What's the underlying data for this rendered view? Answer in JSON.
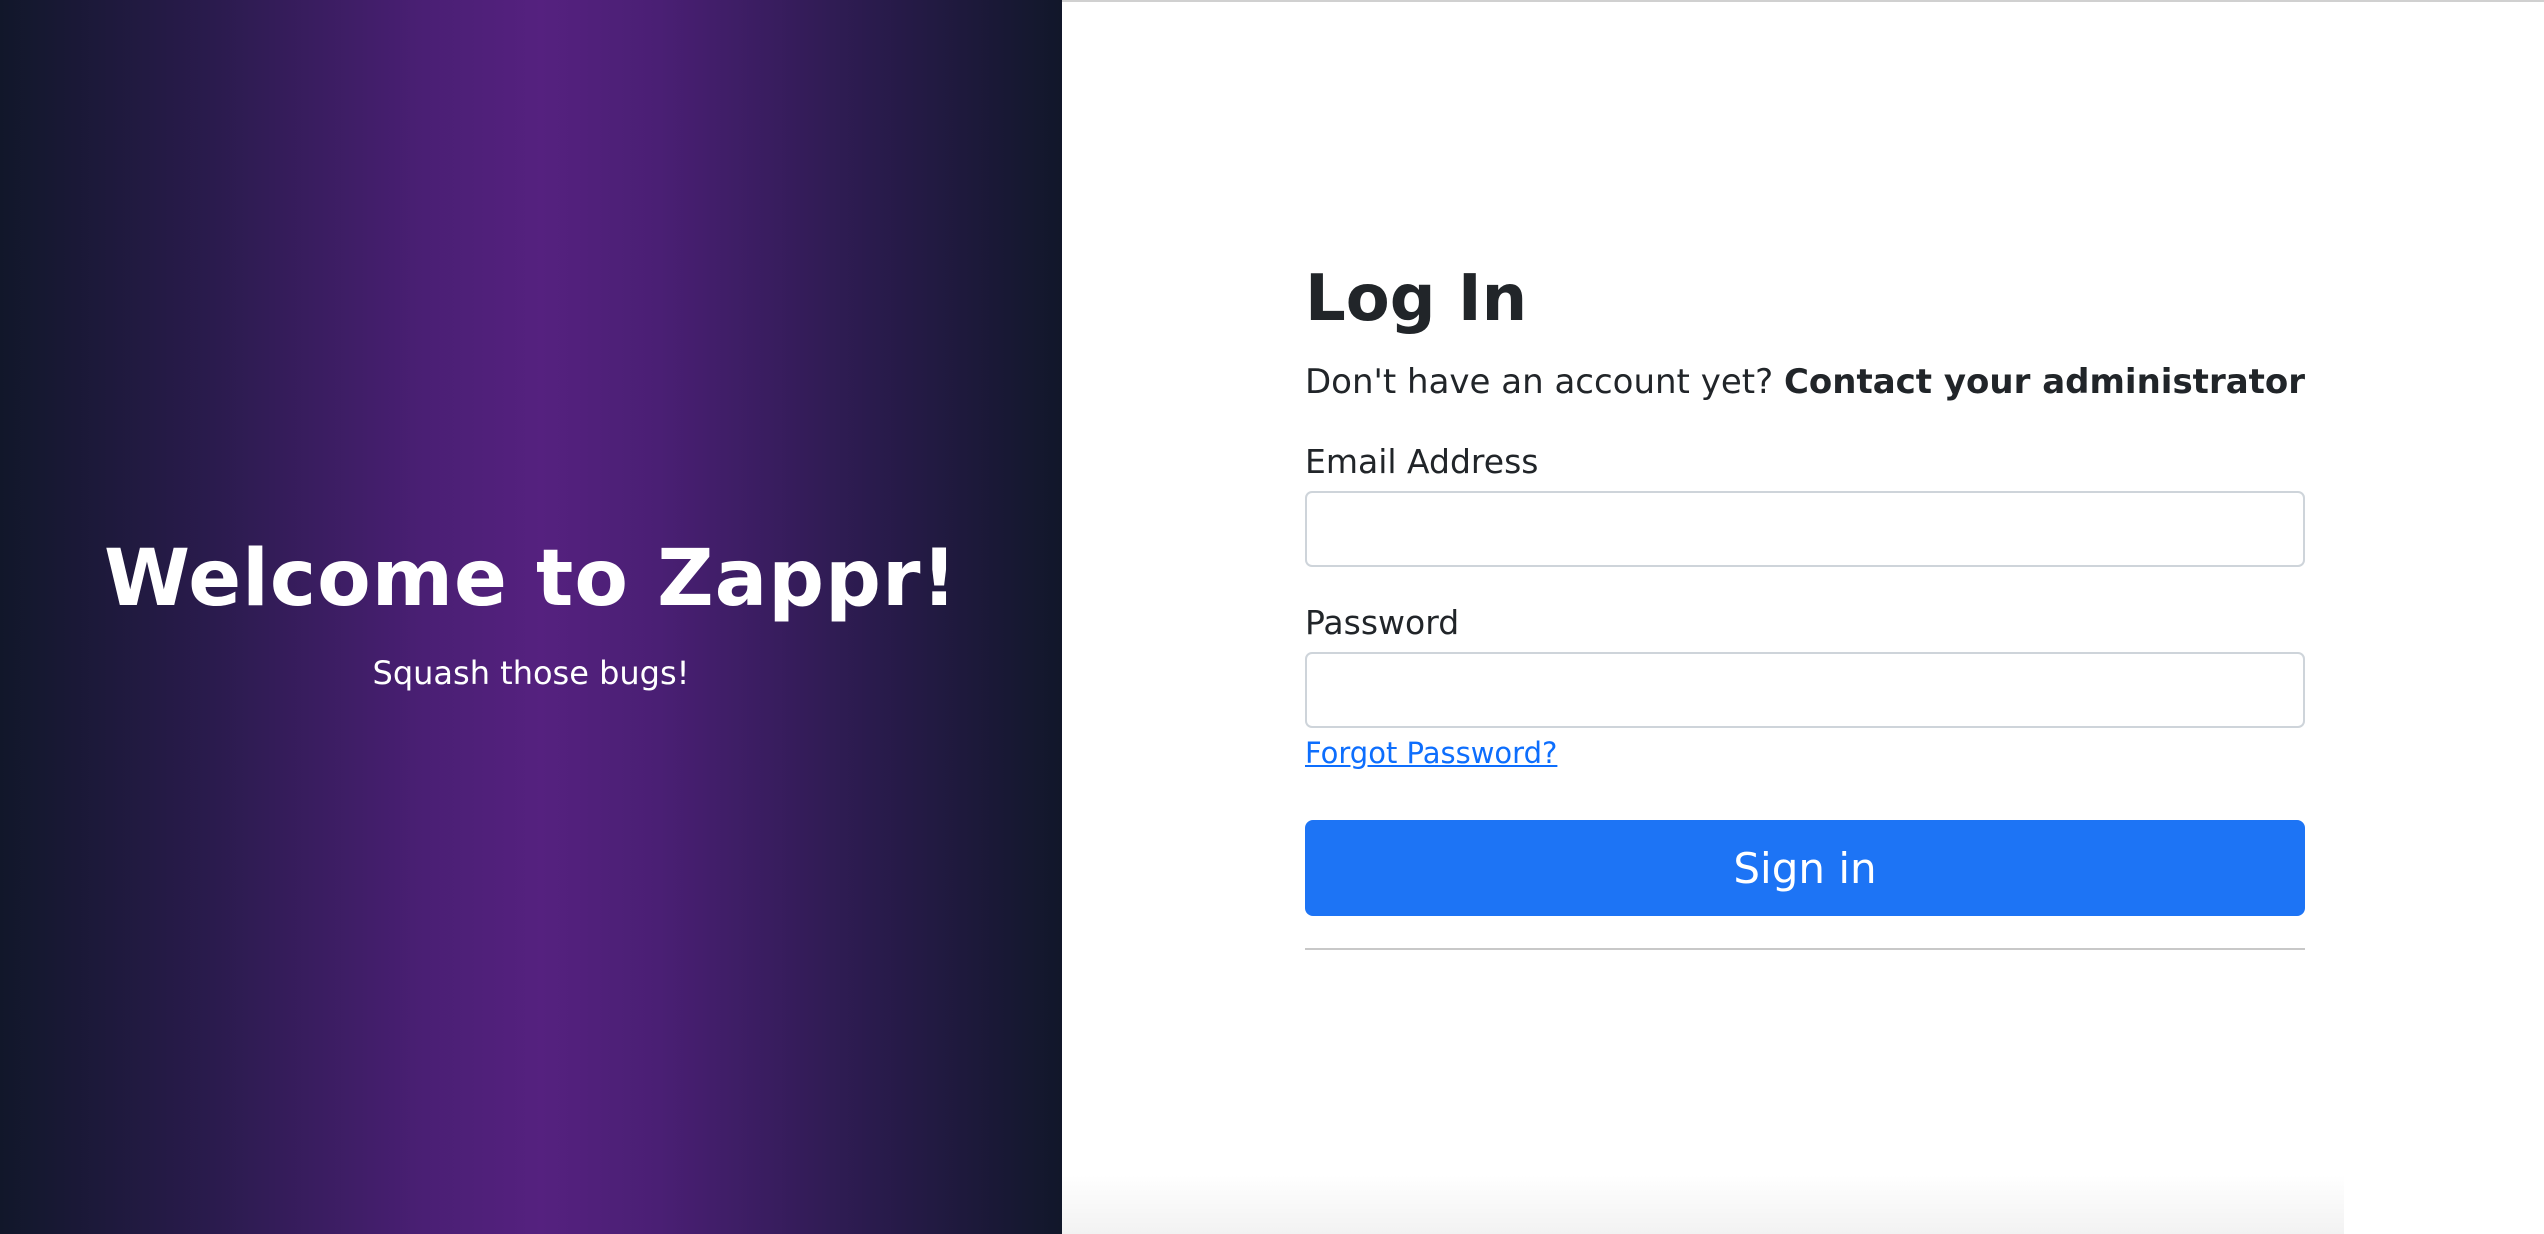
{
  "hero": {
    "title": "Welcome to Zappr!",
    "subtitle": "Squash those bugs!"
  },
  "login": {
    "title": "Log In",
    "no_account_text": "Don't have an account yet?",
    "contact_text": "Contact your administrator",
    "email_label": "Email Address",
    "email_value": "",
    "password_label": "Password",
    "password_value": "",
    "forgot_password": "Forgot Password?",
    "sign_in": "Sign in"
  },
  "colors": {
    "primary_button": "#1d74f5",
    "link": "#0d6efd",
    "hero_center": "#55217f",
    "hero_edge": "#11172a"
  }
}
